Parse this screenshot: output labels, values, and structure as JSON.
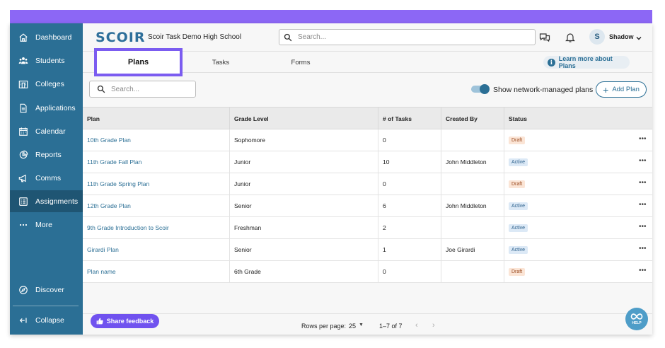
{
  "sidebar": {
    "items": [
      {
        "label": "Dashboard",
        "icon": "home-icon"
      },
      {
        "label": "Students",
        "icon": "students-icon"
      },
      {
        "label": "Colleges",
        "icon": "colleges-icon"
      },
      {
        "label": "Applications",
        "icon": "document-icon"
      },
      {
        "label": "Calendar",
        "icon": "calendar-icon"
      },
      {
        "label": "Reports",
        "icon": "pie-chart-icon"
      },
      {
        "label": "Comms",
        "icon": "megaphone-icon"
      },
      {
        "label": "Assignments",
        "icon": "list-icon",
        "active": true
      },
      {
        "label": "More",
        "icon": "more-icon"
      }
    ],
    "discover": "Discover",
    "collapse": "Collapse"
  },
  "header": {
    "logo": "SCOIR",
    "school": "Scoir Task Demo High School",
    "search_placeholder": "Search...",
    "avatar_initial": "S",
    "user_name": "Shadow"
  },
  "tabs": {
    "plans": "Plans",
    "tasks": "Tasks",
    "forms": "Forms",
    "learn_more": "Learn more about Plans"
  },
  "toolbar": {
    "search_placeholder": "Search...",
    "toggle_label": "Show network-managed plans",
    "toggle_on": true,
    "add_plan": "Add Plan"
  },
  "table": {
    "headers": [
      "Plan",
      "Grade Level",
      "# of Tasks",
      "Created By",
      "Status"
    ],
    "rows": [
      {
        "plan": "10th Grade Plan",
        "grade": "Sophomore",
        "tasks": "0",
        "created_by": "",
        "status": "Draft"
      },
      {
        "plan": "11th Grade Fall Plan",
        "grade": "Junior",
        "tasks": "10",
        "created_by": "John Middleton",
        "status": "Active"
      },
      {
        "plan": "11th Grade Spring Plan",
        "grade": "Junior",
        "tasks": "0",
        "created_by": "",
        "status": "Draft"
      },
      {
        "plan": "12th Grade Plan",
        "grade": "Senior",
        "tasks": "6",
        "created_by": "John Middleton",
        "status": "Active"
      },
      {
        "plan": "9th Grade Introduction to Scoir",
        "grade": "Freshman",
        "tasks": "2",
        "created_by": "",
        "status": "Active"
      },
      {
        "plan": "Girardi Plan",
        "grade": "Senior",
        "tasks": "1",
        "created_by": "Joe Girardi",
        "status": "Active"
      },
      {
        "plan": "Plan name",
        "grade": "6th Grade",
        "tasks": "0",
        "created_by": "",
        "status": "Draft"
      }
    ],
    "row_menu": "•••"
  },
  "footer": {
    "share_feedback": "Share feedback",
    "rows_per_page_label": "Rows per page:",
    "rows_per_page_value": "25",
    "range": "1–7 of 7",
    "prev": "‹",
    "next": "›"
  },
  "help": {
    "label": "HELP"
  },
  "colors": {
    "sidebar": "#2b6f95",
    "sidebar_active": "#1f5573",
    "accent_purple": "#7b5cf0",
    "link": "#2b6f95"
  }
}
